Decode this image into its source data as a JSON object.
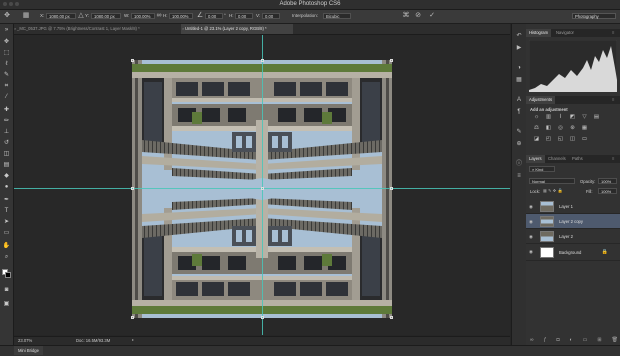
{
  "window": {
    "title": "Adobe Photoshop CS6"
  },
  "options_bar": {
    "x_label": "X:",
    "x_value": "1080.00 px",
    "y_label": "Y:",
    "y_value": "1080.00 px",
    "w_label": "W:",
    "w_value": "100.00%",
    "h_label": "H:",
    "h_value": "100.00%",
    "angle_value": "0.00",
    "h_skew_label": "H:",
    "h_skew_value": "0.00",
    "v_skew_label": "V:",
    "v_skew_value": "0.00",
    "interpolation_label": "Interpolation:",
    "interpolation_value": "Bicubic",
    "workspace": "Photography"
  },
  "tabs": [
    {
      "label": "_MC_0537.JPG @ 7.75% (Brightness/Contrast 1, Layer Mask/8) *",
      "active": false
    },
    {
      "label": "Untitled-1 @ 23.1% (Layer 2 copy, RGB/8) *",
      "active": true
    }
  ],
  "status": {
    "zoom": "23.07%",
    "doc": "Doc: 16.5M/93.3M"
  },
  "mini_bridge": {
    "label": "Mini Bridge"
  },
  "panels": {
    "histogram_tabs": [
      "Histogram",
      "Navigator"
    ],
    "adjustments_tabs": [
      "Adjustments"
    ],
    "adjustments_hint": "Add an adjustment",
    "layers_tabs": [
      "Layers",
      "Channels",
      "Paths"
    ],
    "kind_label": "Kind",
    "blend_mode": "Normal",
    "opacity_label": "Opacity:",
    "opacity_value": "100%",
    "lock_label": "Lock:",
    "fill_label": "Fill:",
    "fill_value": "100%",
    "layers": [
      {
        "name": "Layer 1",
        "selected": false
      },
      {
        "name": "Layer 2 copy",
        "selected": true
      },
      {
        "name": "Layer 2",
        "selected": false
      },
      {
        "name": "Background",
        "selected": false
      }
    ]
  },
  "colors": {
    "guide": "#49c6b9",
    "selection": "#4e5a6e",
    "sky": "#9db5cc",
    "concrete": "#9a9486",
    "foliage": "#5e7a3a"
  }
}
